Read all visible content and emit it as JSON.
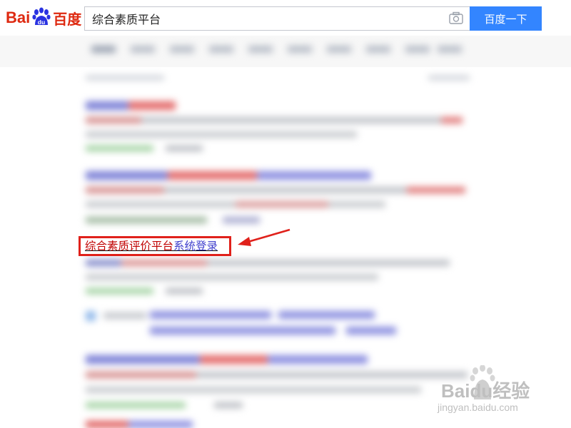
{
  "logo": {
    "latin_part1": "Bai",
    "paw_text": "du",
    "chinese": "百度"
  },
  "search": {
    "query": "综合素质平台",
    "button_label": "百度一下"
  },
  "focus_result": {
    "title_highlight": "综合素质评价平台",
    "title_rest": "系统登录"
  },
  "watermark": {
    "brand": "Bai",
    "brand_du": "du",
    "brand_cn": "经验",
    "url": "jingyan.baidu.com"
  },
  "colors": {
    "brand_red": "#de2910",
    "button_blue": "#3385ff",
    "link_blue": "#3d3dcc",
    "highlight_red": "#c00000",
    "annotation_red": "#e0211b"
  }
}
